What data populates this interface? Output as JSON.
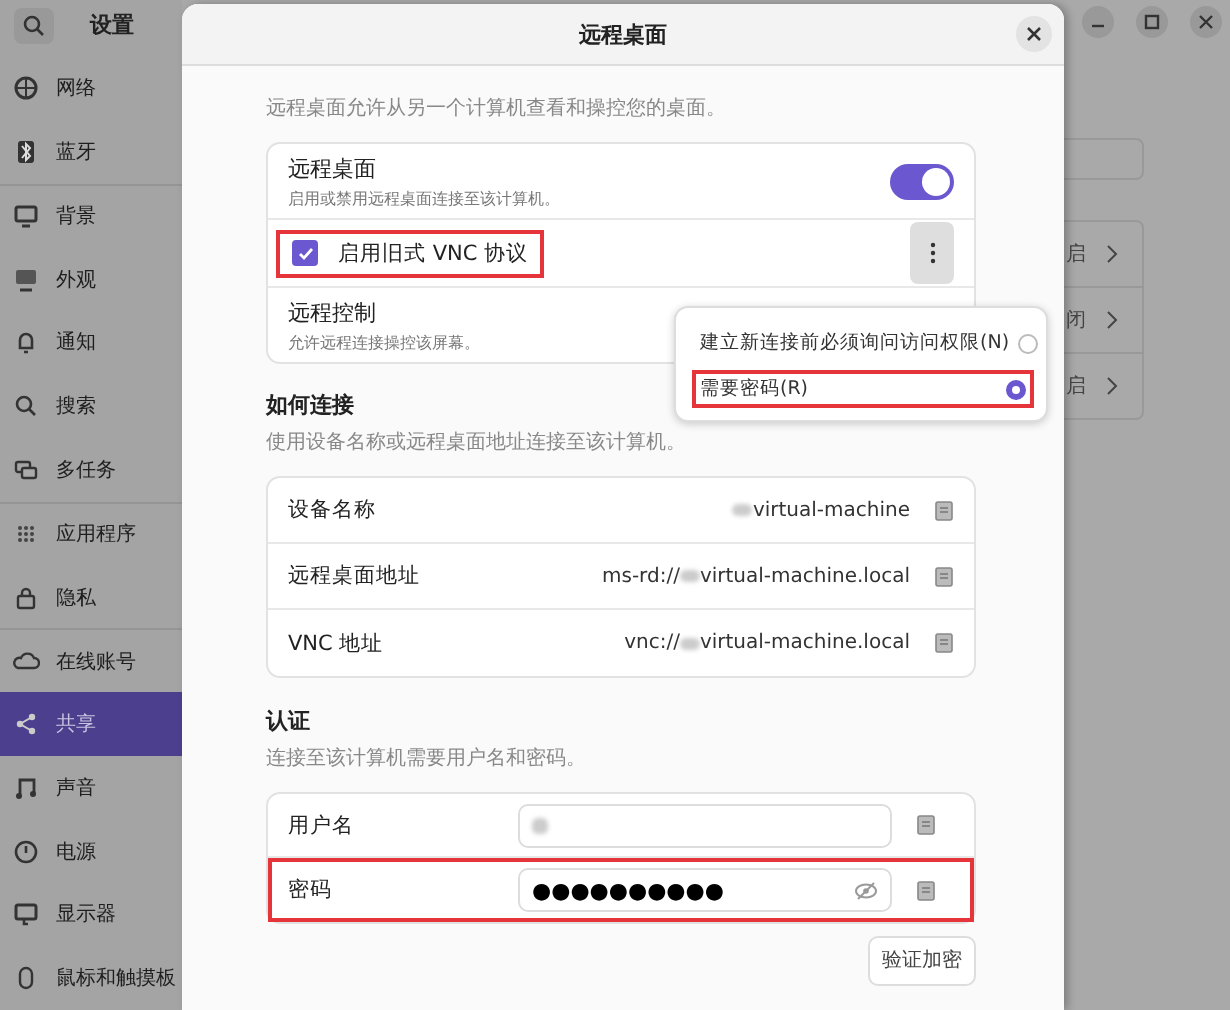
{
  "settings": {
    "title": "设置",
    "sidebar": [
      {
        "label": "网络",
        "selected": false
      },
      {
        "label": "蓝牙",
        "selected": false
      },
      {
        "label": "背景",
        "selected": false
      },
      {
        "label": "外观",
        "selected": false
      },
      {
        "label": "通知",
        "selected": false
      },
      {
        "label": "搜索",
        "selected": false
      },
      {
        "label": "多任务",
        "selected": false
      },
      {
        "label": "应用程序",
        "selected": false
      },
      {
        "label": "隐私",
        "selected": false
      },
      {
        "label": "在线账号",
        "selected": false
      },
      {
        "label": "共享",
        "selected": true
      },
      {
        "label": "声音",
        "selected": false
      },
      {
        "label": "电源",
        "selected": false
      },
      {
        "label": "显示器",
        "selected": false
      },
      {
        "label": "鼠标和触摸板",
        "selected": false
      }
    ],
    "background_rows": [
      {
        "text": "启"
      },
      {
        "text": "闭"
      },
      {
        "text": "启"
      }
    ]
  },
  "dialog": {
    "title": "远程桌面",
    "intro": "远程桌面允许从另一个计算机查看和操控您的桌面。",
    "remote_desktop": {
      "title": "远程桌面",
      "subtitle": "启用或禁用远程桌面连接至该计算机。",
      "on": true
    },
    "vnc": {
      "label": "启用旧式 VNC 协议",
      "checked": true,
      "highlighted": true
    },
    "remote_control": {
      "title": "远程控制",
      "subtitle": "允许远程连接操控该屏幕。"
    },
    "popover": {
      "options": [
        {
          "label": "建立新连接前必须询问访问权限(N)",
          "selected": false,
          "highlighted": false
        },
        {
          "label": "需要密码(R)",
          "selected": true,
          "highlighted": true
        }
      ]
    },
    "connect": {
      "heading": "如何连接",
      "description": "使用设备名称或远程桌面地址连接至该计算机。",
      "rows": [
        {
          "label": "设备名称",
          "suffix": "virtual-machine"
        },
        {
          "label": "远程桌面地址",
          "prefix": "ms-rd://",
          "suffix": "virtual-machine.local"
        },
        {
          "label": "VNC 地址",
          "prefix": "vnc://",
          "suffix": "virtual-machine.local"
        }
      ]
    },
    "auth": {
      "heading": "认证",
      "description": "连接至该计算机需要用户名和密码。",
      "username": {
        "label": "用户名"
      },
      "password": {
        "label": "密码",
        "value": "●●●●●●●●●●",
        "highlighted": true
      }
    },
    "verify_button": "验证加密"
  }
}
